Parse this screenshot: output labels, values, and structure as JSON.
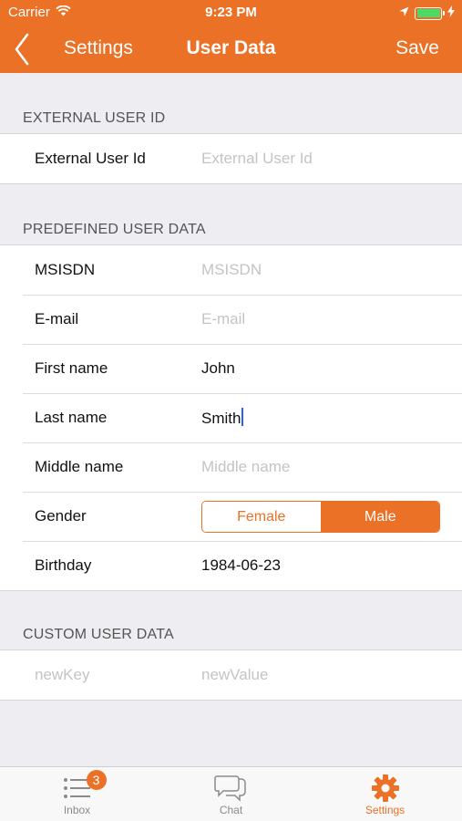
{
  "status_bar": {
    "carrier": "Carrier",
    "time": "9:23 PM",
    "wifi_icon": "wifi-icon",
    "location_icon": "location-arrow-icon",
    "battery_icon": "battery-icon",
    "charging_icon": "bolt-icon"
  },
  "nav": {
    "back_label": "Settings",
    "title": "User Data",
    "save_label": "Save"
  },
  "sections": {
    "external": {
      "header": "EXTERNAL USER ID",
      "rows": [
        {
          "label": "External User Id",
          "value": "",
          "placeholder": "External User Id"
        }
      ]
    },
    "predefined": {
      "header": "PREDEFINED USER DATA",
      "rows": [
        {
          "label": "MSISDN",
          "value": "",
          "placeholder": "MSISDN"
        },
        {
          "label": "E-mail",
          "value": "",
          "placeholder": "E-mail"
        },
        {
          "label": "First name",
          "value": "John",
          "placeholder": ""
        },
        {
          "label": "Last name",
          "value": "Smith",
          "placeholder": ""
        },
        {
          "label": "Middle name",
          "value": "",
          "placeholder": "Middle name"
        },
        {
          "label": "Gender",
          "options": [
            "Female",
            "Male"
          ],
          "selected": "Male"
        },
        {
          "label": "Birthday",
          "value": "1984-06-23"
        }
      ]
    },
    "custom": {
      "header": "CUSTOM USER DATA",
      "rows": [
        {
          "key_placeholder": "newKey",
          "value_placeholder": "newValue"
        }
      ]
    }
  },
  "tabbar": {
    "tabs": [
      {
        "label": "Inbox",
        "icon": "list-icon",
        "badge": "3"
      },
      {
        "label": "Chat",
        "icon": "chat-bubbles-icon"
      },
      {
        "label": "Settings",
        "icon": "gear-icon",
        "active": true
      }
    ]
  },
  "colors": {
    "accent": "#ea7125",
    "background": "#ededf2",
    "placeholder": "#c4c4c8"
  }
}
